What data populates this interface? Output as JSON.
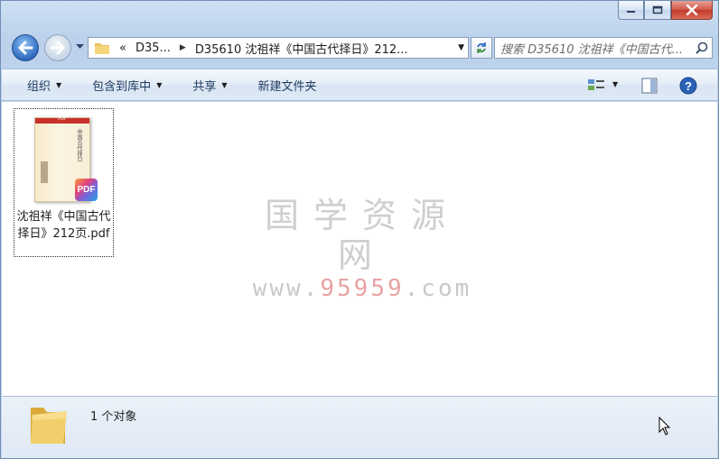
{
  "window": {
    "caption_buttons": [
      "minimize",
      "maximize",
      "close"
    ]
  },
  "address_bar": {
    "overflow_chevron": "«",
    "crumbs": [
      "D35...",
      "D35610 沈祖祥《中国古代择日》212..."
    ]
  },
  "search": {
    "placeholder": "搜索 D35610 沈祖祥《中国古代..."
  },
  "toolbar": {
    "organize": "组织",
    "include_library": "包含到库中",
    "share": "共享",
    "new_folder": "新建文件夹"
  },
  "files": [
    {
      "name": "沈祖祥《中国古代择日》212页.pdf",
      "thumb_header": "PDF",
      "thumb_title": "中国古代择日",
      "badge": "PDF"
    }
  ],
  "watermark": {
    "cn": "国学资源网",
    "url_prefix": "www.",
    "url_highlight": "95959",
    "url_suffix": ".com"
  },
  "details": {
    "count_text": "1 个对象"
  },
  "colors": {
    "accent": "#2f6bbf",
    "close": "#c23a2b",
    "watermark_highlight": "#eaa3a3"
  }
}
